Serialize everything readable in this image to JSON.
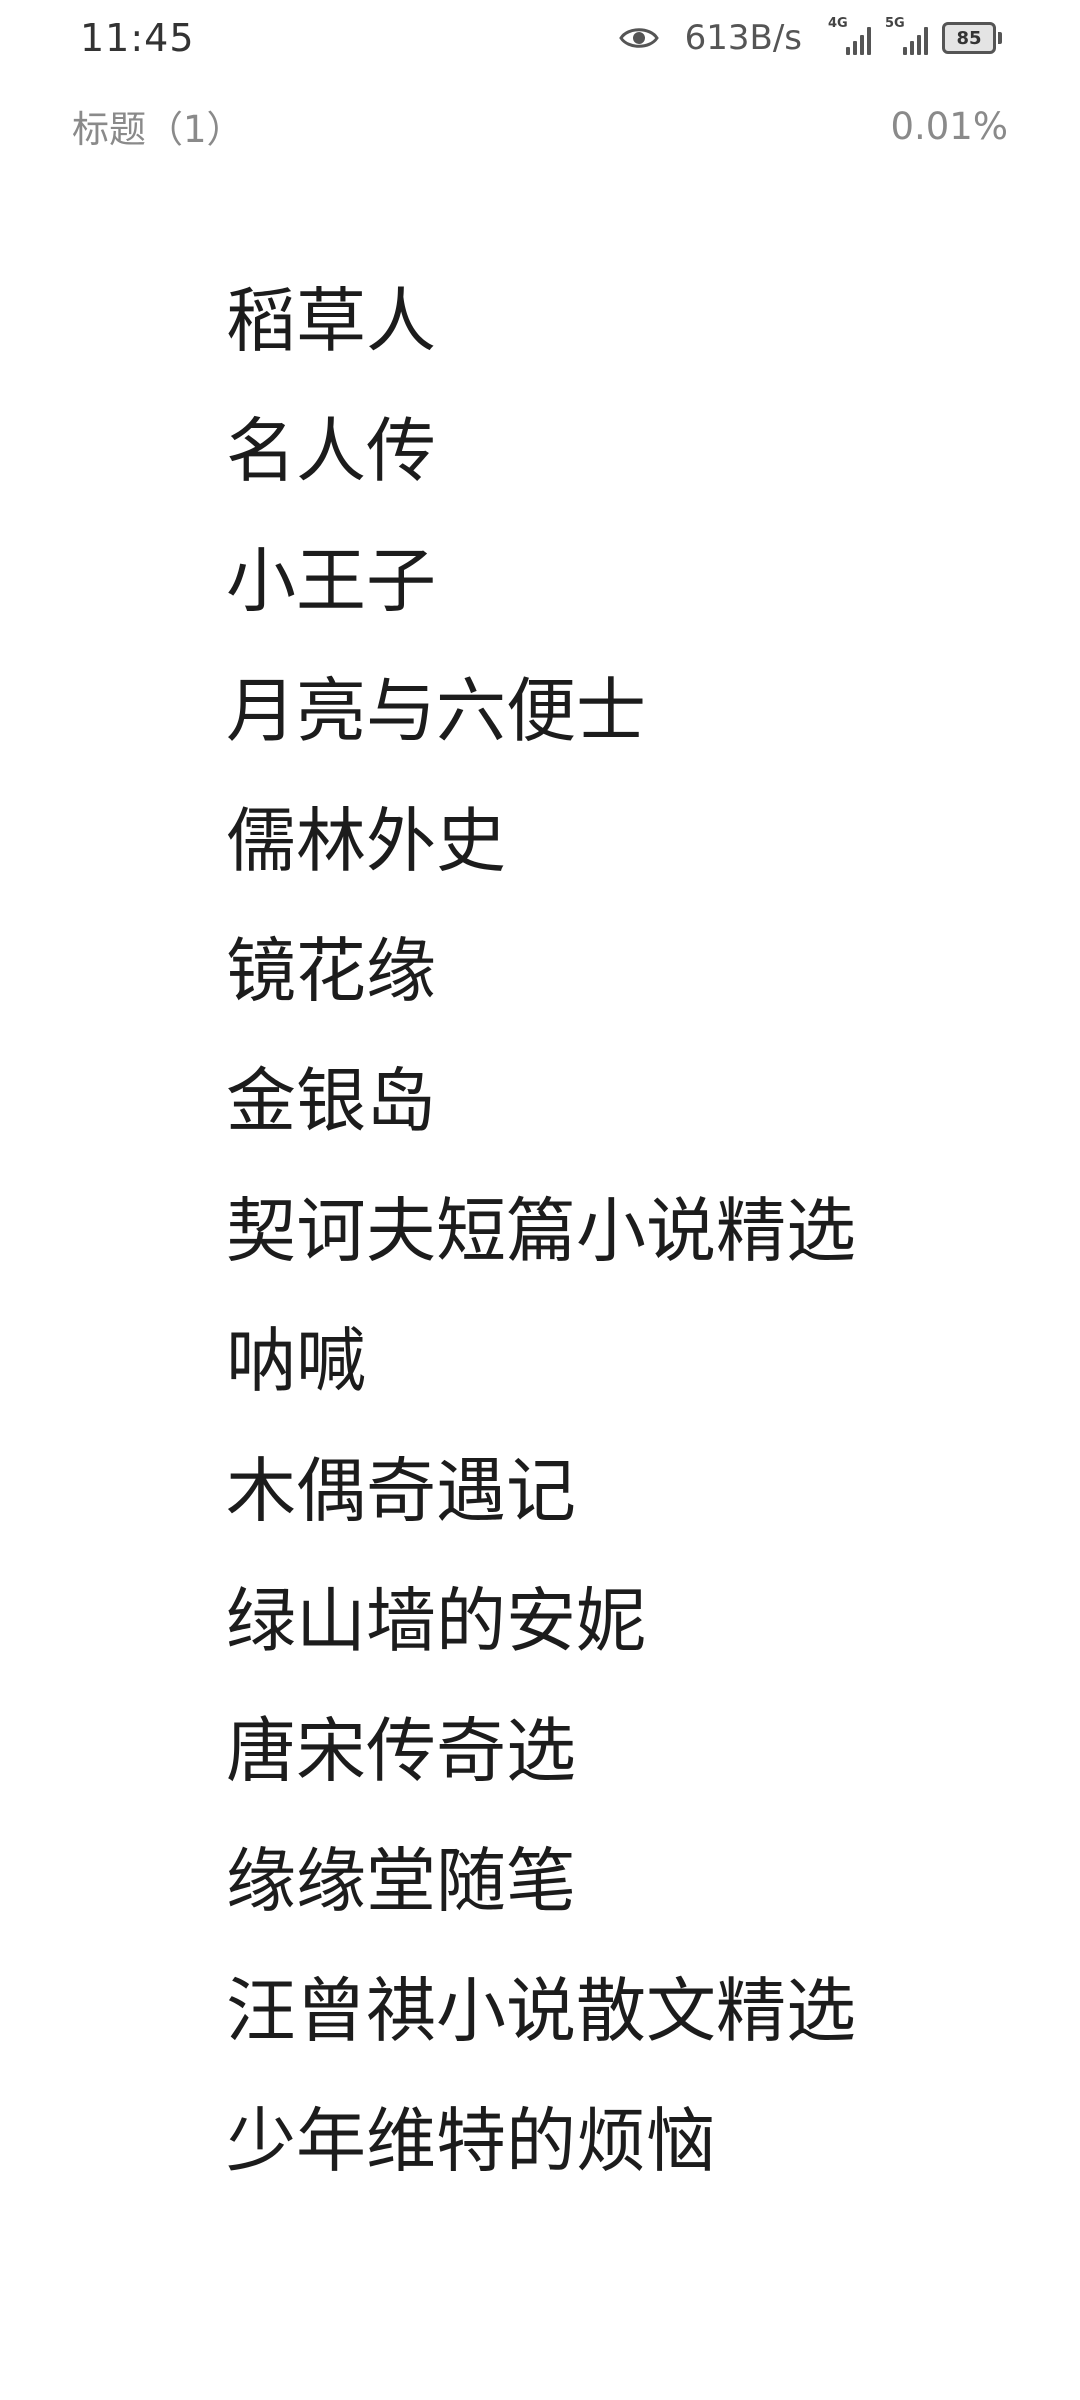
{
  "status_bar": {
    "time": "11:45",
    "net_speed": "613B/s",
    "signal1_label": "4G",
    "signal2_label": "5G",
    "battery": "85"
  },
  "header": {
    "title": "标题（1）",
    "progress": "0.01%"
  },
  "chapters": [
    "稻草人",
    "名人传",
    "小王子",
    "月亮与六便士",
    "儒林外史",
    "镜花缘",
    "金银岛",
    "契诃夫短篇小说精选",
    "呐喊",
    "木偶奇遇记",
    "绿山墙的安妮",
    "唐宋传奇选",
    "缘缘堂随笔",
    "汪曾祺小说散文精选",
    "少年维特的烦恼"
  ]
}
